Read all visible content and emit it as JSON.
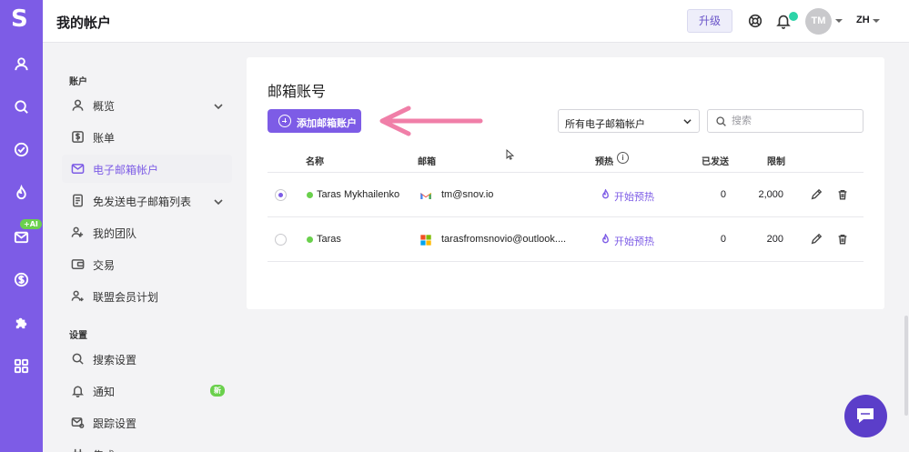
{
  "app": {
    "logo": "S",
    "ai_badge": "+AI"
  },
  "header": {
    "title": "我的帐户",
    "upgrade_label": "升级",
    "avatar_initials": "TM",
    "language": "ZH"
  },
  "sidebar": {
    "account_section": "账户",
    "settings_section": "设置",
    "items": [
      {
        "label": "概览",
        "icon": "user-icon"
      },
      {
        "label": "账单",
        "icon": "dollar-icon"
      },
      {
        "label": "电子邮箱帐户",
        "icon": "mail-icon",
        "active": true
      },
      {
        "label": "免发送电子邮箱列表",
        "icon": "list-icon"
      },
      {
        "label": "我的团队",
        "icon": "team-icon"
      },
      {
        "label": "交易",
        "icon": "wallet-icon"
      },
      {
        "label": "联盟会员计划",
        "icon": "user-plus-icon"
      }
    ],
    "settings_items": [
      {
        "label": "搜索设置",
        "icon": "search-icon"
      },
      {
        "label": "通知",
        "icon": "bell-icon",
        "badge": "新"
      },
      {
        "label": "跟踪设置",
        "icon": "mail-tracking-icon"
      },
      {
        "label": "集成",
        "icon": "plug-icon"
      }
    ]
  },
  "main": {
    "title": "邮箱账号",
    "add_button": "添加邮箱账户",
    "filter": {
      "value": "所有电子邮箱帐户"
    },
    "search": {
      "placeholder": "搜索",
      "value": ""
    },
    "columns": {
      "name": "名称",
      "email": "邮箱",
      "warmup": "预热",
      "sent": "已发送",
      "limit": "限制"
    },
    "rows": [
      {
        "selected": true,
        "name": "Taras Mykhailenko",
        "provider": "gmail",
        "email": "tm@snov.io",
        "warmup": "开始预热",
        "sent": "0",
        "limit": "2,000"
      },
      {
        "selected": false,
        "name": "Taras",
        "provider": "microsoft",
        "email": "tarasfromsnovio@outlook....",
        "warmup": "开始预热",
        "sent": "0",
        "limit": "200"
      }
    ]
  },
  "colors": {
    "brand": "#7d5ce6",
    "status_green": "#6ad04c",
    "arrow_pink": "#f07fa8",
    "chat": "#5b3ec9"
  }
}
